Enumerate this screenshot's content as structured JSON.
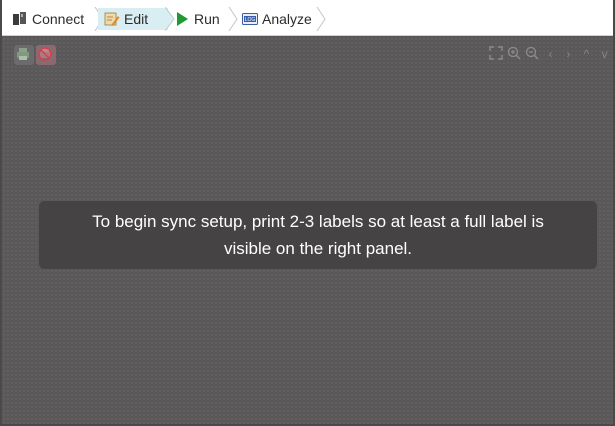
{
  "breadcrumb": {
    "items": [
      {
        "label": "Connect",
        "icon": "connect-icon"
      },
      {
        "label": "Edit",
        "icon": "edit-icon",
        "active": true
      },
      {
        "label": "Run",
        "icon": "play-icon"
      },
      {
        "label": "Analyze",
        "icon": "log-icon",
        "icon_text": "LOG"
      }
    ]
  },
  "toolbar_left": [
    {
      "icon": "print-icon"
    },
    {
      "icon": "no-print-icon"
    }
  ],
  "toolbar_right": [
    {
      "icon": "fit-screen-icon"
    },
    {
      "icon": "zoom-in-icon"
    },
    {
      "icon": "zoom-out-icon"
    },
    {
      "icon": "chevron-left-icon",
      "glyph": "‹"
    },
    {
      "icon": "chevron-right-icon",
      "glyph": "›"
    },
    {
      "icon": "chevron-up-icon",
      "glyph": "^"
    },
    {
      "icon": "chevron-down-icon",
      "glyph": "v"
    }
  ],
  "message": {
    "line1": "To begin sync setup, print 2-3 labels so at least a full label is",
    "line2": "visible on the right panel."
  },
  "colors": {
    "canvas": "#5a5758",
    "active_crumb": "#d9eef2",
    "run_green": "#1e9a2e",
    "message_bg": "#444142"
  }
}
